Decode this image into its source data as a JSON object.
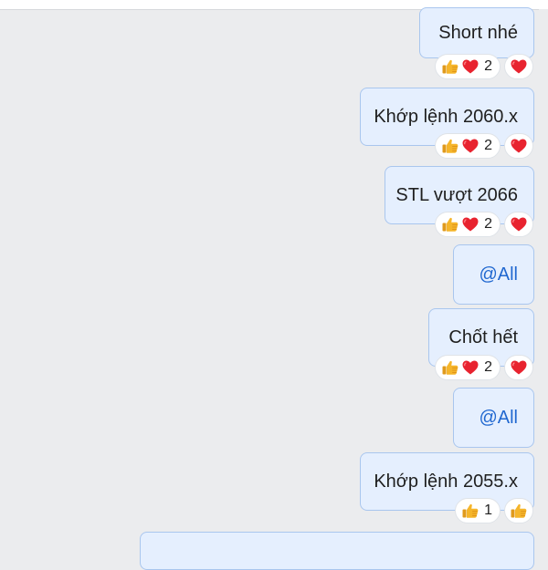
{
  "messages": [
    {
      "text": "Short nhé",
      "mention": false,
      "reactions": {
        "icons": [
          "thumbs-up-icon",
          "heart-icon"
        ],
        "count": "2",
        "quick": "heart-icon"
      }
    },
    {
      "text": "Khớp lệnh 2060.x",
      "mention": false,
      "reactions": {
        "icons": [
          "thumbs-up-icon",
          "heart-icon"
        ],
        "count": "2",
        "quick": "heart-icon"
      }
    },
    {
      "text": "STL vượt 2066",
      "mention": false,
      "reactions": {
        "icons": [
          "thumbs-up-icon",
          "heart-icon"
        ],
        "count": "2",
        "quick": "heart-icon"
      }
    },
    {
      "text": "@All",
      "mention": true
    },
    {
      "text": "Chốt hết",
      "mention": false,
      "reactions": {
        "icons": [
          "thumbs-up-icon",
          "heart-icon"
        ],
        "count": "2",
        "quick": "heart-icon"
      }
    },
    {
      "text": "@All",
      "mention": true
    },
    {
      "text": "Khớp lệnh 2055.x",
      "mention": false,
      "reactions": {
        "icons": [
          "thumbs-up-icon"
        ],
        "count": "1",
        "quick": "thumbs-up-icon"
      }
    }
  ],
  "colors": {
    "background": "#ebecee",
    "bubble": "#e5effe",
    "bubble_border": "#a9c6ee",
    "mention": "#2168d0",
    "heart": "#e8232f",
    "thumb": "#f5b52a"
  }
}
